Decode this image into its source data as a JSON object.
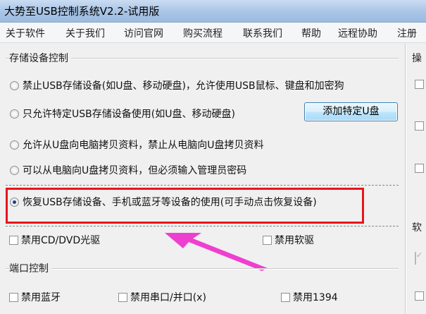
{
  "window": {
    "title": "大势至USB控制系统V2.2-试用版"
  },
  "menu": [
    "关于软件",
    "关于我们",
    "访问官网",
    "购买流程",
    "联系我们",
    "帮助",
    "远程协助",
    "注册"
  ],
  "storage_group": {
    "title": "存储设备控制",
    "options": [
      {
        "label": "禁止USB存储设备(如U盘、移动硬盘)，允许使用USB鼠标、键盘和加密狗",
        "selected": false
      },
      {
        "label": "只允许特定USB存储设备使用(如U盘、移动硬盘)",
        "selected": false
      },
      {
        "label": "允许从U盘向电脑拷贝资料，禁止从电脑向U盘拷贝资料",
        "selected": false
      },
      {
        "label": "可以从电脑向U盘拷贝资料，但必须输入管理员密码",
        "selected": false
      },
      {
        "label": "恢复USB存储设备、手机或蓝牙等设备的使用(可手动点击恢复设备)",
        "selected": true
      }
    ],
    "add_button": "添加特定U盘",
    "highlight_color": "#e8151b",
    "arrow_color": "#ef3fd0"
  },
  "drive_checks": [
    {
      "label": "禁用CD/DVD光驱",
      "checked": false
    },
    {
      "label": "禁用软驱",
      "checked": false
    }
  ],
  "port_group": {
    "title": "端口控制",
    "checks": [
      {
        "label": "禁用蓝牙",
        "checked": false
      },
      {
        "label": "禁用串口/并口(x)",
        "checked": false
      },
      {
        "label": "禁用1394",
        "checked": false
      }
    ]
  },
  "right_panel": {
    "title_top": "操",
    "title_mid": "软"
  }
}
